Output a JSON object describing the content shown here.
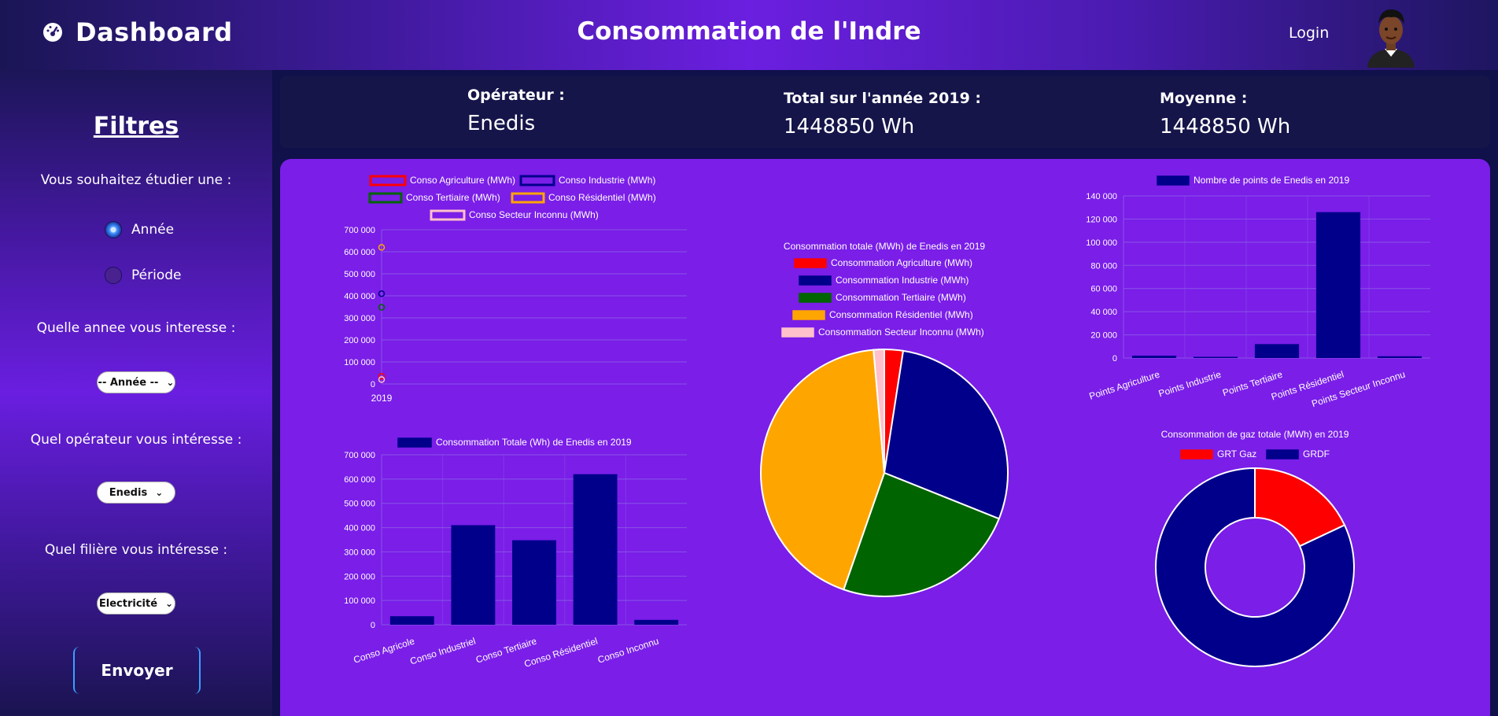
{
  "header": {
    "brand_icon": "speedometer-icon",
    "brand_title": "Dashboard",
    "page_title": "Consommation de l'Indre",
    "login_label": "Login",
    "avatar": "user-avatar"
  },
  "sidebar": {
    "title": "Filtres",
    "question_type": "Vous souhaitez étudier une :",
    "option_year": "Année",
    "option_period": "Période",
    "selected_option": "Année",
    "question_year": "Quelle annee vous interesse :",
    "year_select": "-- Année --",
    "question_operator": "Quel opérateur vous intéresse :",
    "operator_select": "Enedis",
    "question_sector": "Quel filière vous intéresse :",
    "sector_select": "Electricité",
    "submit_label": "Envoyer"
  },
  "info": {
    "operator_label": "Opérateur :",
    "operator_value": "Enedis",
    "total_label": "Total sur l'année 2019 :",
    "total_value": "1448850 Wh",
    "mean_label": "Moyenne :",
    "mean_value": "1448850 Wh"
  },
  "colors": {
    "agriculture": "#ff0000",
    "industrie": "#00008b",
    "tertiaire": "#006400",
    "residentiel": "#ffa500",
    "inconnu": "#ffc0cb",
    "panel": "#7a1ee8"
  },
  "chart_data": [
    {
      "type": "scatter",
      "legend": [
        "Conso Agriculture (MWh)",
        "Conso Industrie (MWh)",
        "Conso Tertiaire  (MWh)",
        "Conso Résidentiel  (MWh)",
        "Conso Secteur Inconnu (MWh)"
      ],
      "x": [
        "2019"
      ],
      "series": [
        {
          "name": "Conso Agriculture (MWh)",
          "values": [
            35000
          ]
        },
        {
          "name": "Conso Industrie (MWh)",
          "values": [
            410000
          ]
        },
        {
          "name": "Conso Tertiaire  (MWh)",
          "values": [
            348000
          ]
        },
        {
          "name": "Conso Résidentiel  (MWh)",
          "values": [
            620000
          ]
        },
        {
          "name": "Conso Secteur Inconnu (MWh)",
          "values": [
            20000
          ]
        }
      ],
      "yticks": [
        "0",
        "100 000",
        "200 000",
        "300 000",
        "400 000",
        "500 000",
        "600 000",
        "700 000"
      ],
      "ylim": [
        0,
        700000
      ]
    },
    {
      "type": "bar",
      "legend": [
        "Consommation Totale (Wh) de Enedis en 2019"
      ],
      "categories": [
        "Conso Agricole",
        "Conso Industriel",
        "Conso Tertiaire",
        "Conso Résidentiel",
        "Conso Inconnu"
      ],
      "values": [
        35000,
        410000,
        348000,
        620000,
        20000
      ],
      "yticks": [
        "0",
        "100 000",
        "200 000",
        "300 000",
        "400 000",
        "500 000",
        "600 000",
        "700 000"
      ],
      "ylim": [
        0,
        700000
      ]
    },
    {
      "type": "pie",
      "title": "Consommation totale (MWh) de Enedis en 2019",
      "labels": [
        "Consommation Agriculture (MWh)",
        "Consommation Industrie (MWh)",
        "Consommation Tertiaire  (MWh)",
        "Consommation Résidentiel  (MWh)",
        "Consommation Secteur Inconnu (MWh)"
      ],
      "values": [
        35000,
        410000,
        348000,
        620000,
        20000
      ]
    },
    {
      "type": "bar",
      "legend": [
        "Nombre de points de Enedis  en 2019"
      ],
      "categories": [
        "Points Agriculture",
        "Points Industrie",
        "Points Tertiaire",
        "Points Résidentiel",
        "Points Secteur Inconnu"
      ],
      "values": [
        2000,
        500,
        12000,
        126000,
        1500
      ],
      "yticks": [
        "0",
        "20 000",
        "40 000",
        "60 000",
        "80 000",
        "100 000",
        "120 000",
        "140 000"
      ],
      "ylim": [
        0,
        140000
      ]
    },
    {
      "type": "pie",
      "subtype": "doughnut",
      "title": "Consommation de gaz totale (MWh)  en 2019",
      "labels": [
        "GRT Gaz",
        "GRDF"
      ],
      "values": [
        18,
        82
      ]
    }
  ]
}
